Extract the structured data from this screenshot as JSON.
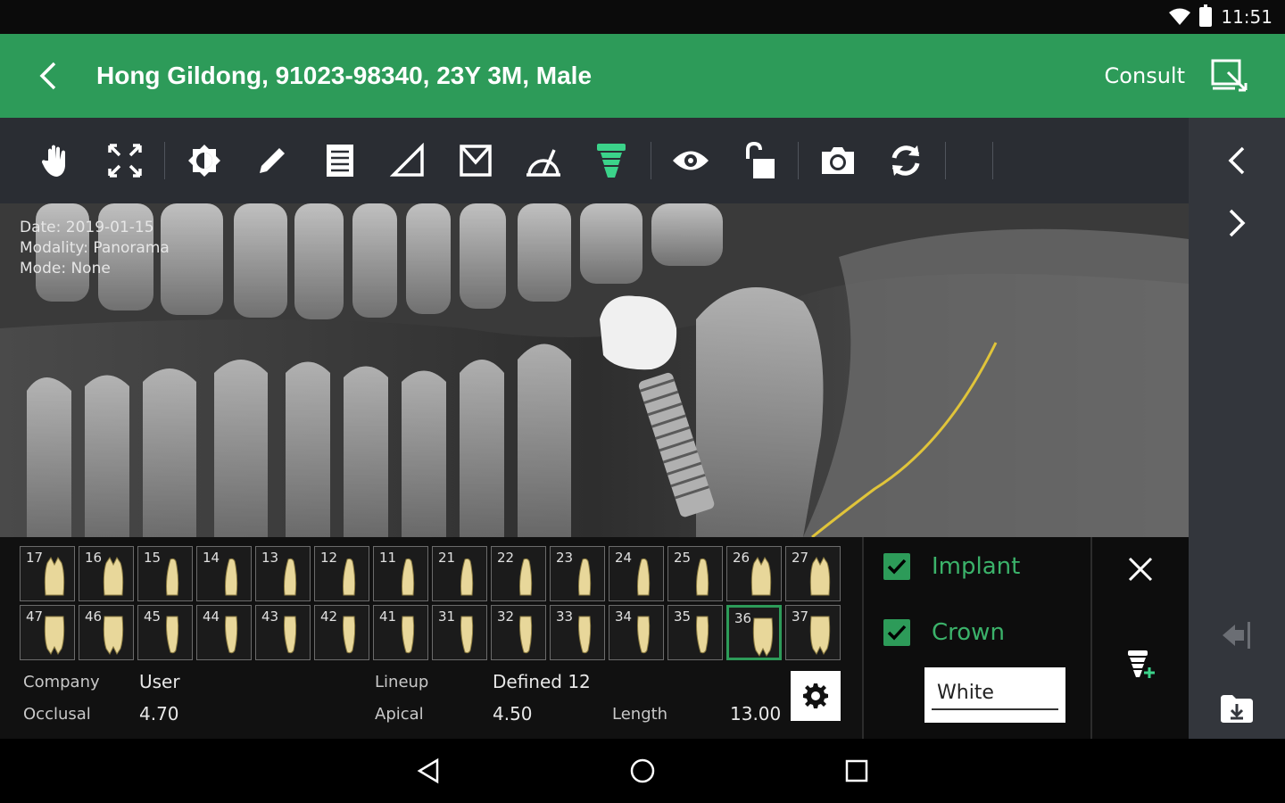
{
  "status_bar": {
    "time": "11:51"
  },
  "header": {
    "title": "Hong Gildong, 91023-98340, 23Y 3M, Male",
    "consult_label": "Consult"
  },
  "toolbar": {
    "tools": [
      "hand-icon",
      "fullscreen-icon",
      "contrast-icon",
      "pencil-icon",
      "notes-icon",
      "ruler-icon",
      "angle-icon",
      "protractor-icon",
      "implant-icon",
      "eye-icon",
      "unlock-icon",
      "camera-icon",
      "rotate-icon"
    ],
    "active_tool": "implant-icon"
  },
  "image_info": {
    "date": "Date: 2019-01-15",
    "modality": "Modality: Panorama",
    "mode": "Mode: None"
  },
  "teeth": {
    "upper": [
      "17",
      "16",
      "15",
      "14",
      "13",
      "12",
      "11",
      "21",
      "22",
      "23",
      "24",
      "25",
      "26",
      "27"
    ],
    "lower": [
      "47",
      "46",
      "45",
      "44",
      "43",
      "42",
      "41",
      "31",
      "32",
      "33",
      "34",
      "35",
      "36",
      "37"
    ],
    "selected": "36"
  },
  "implant_params": {
    "company_label": "Company",
    "company_value": "User",
    "lineup_label": "Lineup",
    "lineup_value": "Defined 12",
    "occlusal_label": "Occlusal",
    "occlusal_value": "4.70",
    "apical_label": "Apical",
    "apical_value": "4.50",
    "length_label": "Length",
    "length_value": "13.00"
  },
  "options": {
    "implant_label": "Implant",
    "implant_checked": true,
    "crown_label": "Crown",
    "crown_checked": true,
    "crown_color": "White"
  },
  "colors": {
    "accent": "#2d9b59",
    "nerve_line": "#e0c43a",
    "toolbar": "#2a2d33"
  }
}
